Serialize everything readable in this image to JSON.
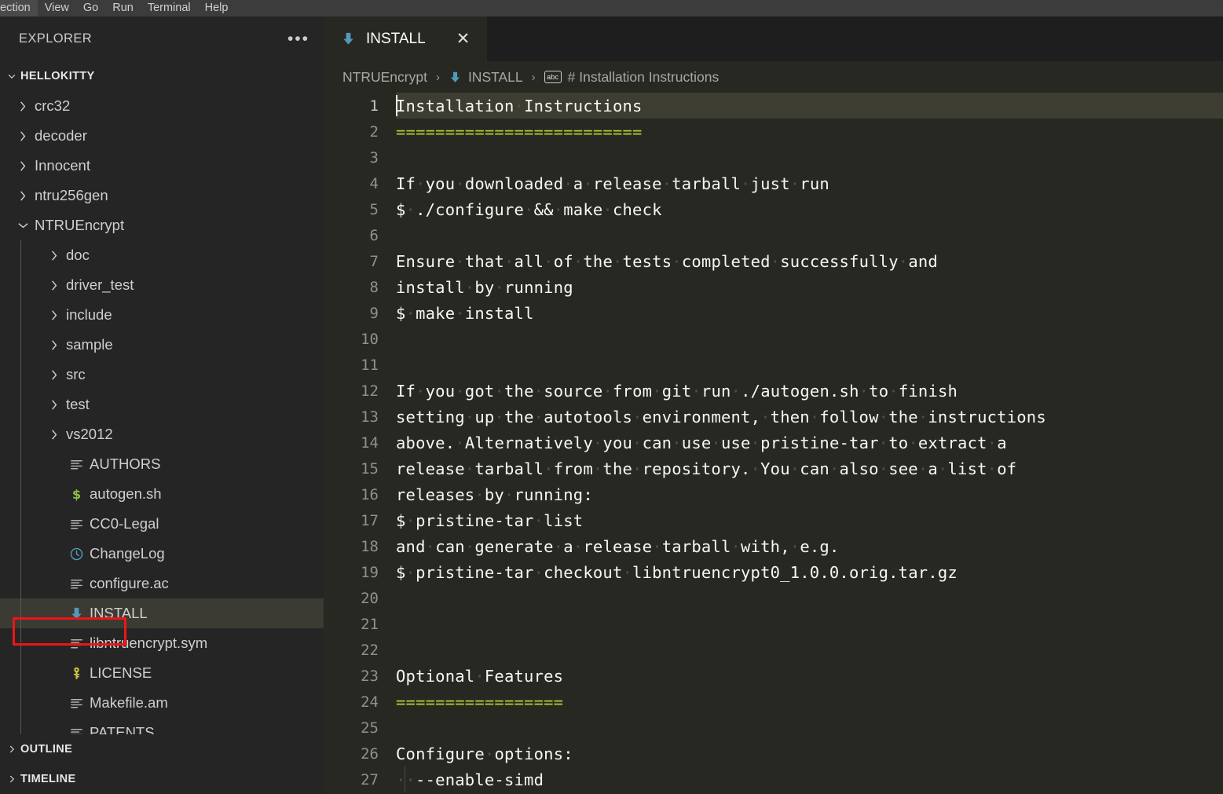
{
  "menubar": {
    "items": [
      "ection",
      "View",
      "Go",
      "Run",
      "Terminal",
      "Help"
    ]
  },
  "sidebar": {
    "title": "EXPLORER",
    "more_label": "•••",
    "root": {
      "label": "HELLOKITTY",
      "expanded": true
    },
    "tree": [
      {
        "label": "crc32",
        "type": "folder",
        "depth": 0,
        "expanded": false,
        "icon": "chevron-right-icon"
      },
      {
        "label": "decoder",
        "type": "folder",
        "depth": 0,
        "expanded": false,
        "icon": "chevron-right-icon"
      },
      {
        "label": "Innocent",
        "type": "folder",
        "depth": 0,
        "expanded": false,
        "icon": "chevron-right-icon"
      },
      {
        "label": "ntru256gen",
        "type": "folder",
        "depth": 0,
        "expanded": false,
        "icon": "chevron-right-icon"
      },
      {
        "label": "NTRUEncrypt",
        "type": "folder",
        "depth": 0,
        "expanded": true,
        "icon": "chevron-down-icon"
      },
      {
        "label": "doc",
        "type": "folder",
        "depth": 1,
        "expanded": false,
        "icon": "chevron-right-icon"
      },
      {
        "label": "driver_test",
        "type": "folder",
        "depth": 1,
        "expanded": false,
        "icon": "chevron-right-icon"
      },
      {
        "label": "include",
        "type": "folder",
        "depth": 1,
        "expanded": false,
        "icon": "chevron-right-icon"
      },
      {
        "label": "sample",
        "type": "folder",
        "depth": 1,
        "expanded": false,
        "icon": "chevron-right-icon"
      },
      {
        "label": "src",
        "type": "folder",
        "depth": 1,
        "expanded": false,
        "icon": "chevron-right-icon"
      },
      {
        "label": "test",
        "type": "folder",
        "depth": 1,
        "expanded": false,
        "icon": "chevron-right-icon"
      },
      {
        "label": "vs2012",
        "type": "folder",
        "depth": 1,
        "expanded": false,
        "icon": "chevron-right-icon"
      },
      {
        "label": "AUTHORS",
        "type": "file",
        "depth": 1,
        "icon": "text-lines-icon"
      },
      {
        "label": "autogen.sh",
        "type": "file",
        "depth": 1,
        "icon": "shell-dollar-icon"
      },
      {
        "label": "CC0-Legal",
        "type": "file",
        "depth": 1,
        "icon": "text-lines-icon"
      },
      {
        "label": "ChangeLog",
        "type": "file",
        "depth": 1,
        "icon": "clock-icon"
      },
      {
        "label": "configure.ac",
        "type": "file",
        "depth": 1,
        "icon": "text-lines-icon"
      },
      {
        "label": "INSTALL",
        "type": "file",
        "depth": 1,
        "icon": "download-arrow-icon",
        "selected": true,
        "highlighted": true
      },
      {
        "label": "libntruencrypt.sym",
        "type": "file",
        "depth": 1,
        "icon": "text-lines-icon"
      },
      {
        "label": "LICENSE",
        "type": "file",
        "depth": 1,
        "icon": "key-icon"
      },
      {
        "label": "Makefile.am",
        "type": "file",
        "depth": 1,
        "icon": "text-lines-icon"
      },
      {
        "label": "PATENTS",
        "type": "file",
        "depth": 1,
        "icon": "text-lines-icon"
      }
    ],
    "panels": [
      {
        "label": "OUTLINE",
        "expanded": false
      },
      {
        "label": "TIMELINE",
        "expanded": false
      }
    ]
  },
  "editor": {
    "tab": {
      "label": "INSTALL",
      "icon": "download-arrow-icon",
      "close_label": "✕",
      "active": true
    },
    "breadcrumb": [
      {
        "label": "NTRUEncrypt",
        "icon": null
      },
      {
        "label": "INSTALL",
        "icon": "download-arrow-icon"
      },
      {
        "label": "# Installation Instructions",
        "icon": "abc-symbol-icon"
      }
    ],
    "breadcrumb_separator": "›",
    "cursor_line": 1,
    "lines": [
      {
        "n": 1,
        "text": "Installation·Instructions",
        "active": true
      },
      {
        "n": 2,
        "text": "=========================",
        "eq": true
      },
      {
        "n": 3,
        "text": ""
      },
      {
        "n": 4,
        "text": "If·you·downloaded·a·release·tarball·just·run"
      },
      {
        "n": 5,
        "text": "$·./configure·&&·make·check"
      },
      {
        "n": 6,
        "text": ""
      },
      {
        "n": 7,
        "text": "Ensure·that·all·of·the·tests·completed·successfully·and"
      },
      {
        "n": 8,
        "text": "install·by·running"
      },
      {
        "n": 9,
        "text": "$·make·install"
      },
      {
        "n": 10,
        "text": ""
      },
      {
        "n": 11,
        "text": ""
      },
      {
        "n": 12,
        "text": "If·you·got·the·source·from·git·run·./autogen.sh·to·finish"
      },
      {
        "n": 13,
        "text": "setting·up·the·autotools·environment,·then·follow·the·instructions"
      },
      {
        "n": 14,
        "text": "above.·Alternatively·you·can·use·use·pristine-tar·to·extract·a"
      },
      {
        "n": 15,
        "text": "release·tarball·from·the·repository.·You·can·also·see·a·list·of"
      },
      {
        "n": 16,
        "text": "releases·by·running:"
      },
      {
        "n": 17,
        "text": "$·pristine-tar·list"
      },
      {
        "n": 18,
        "text": "and·can·generate·a·release·tarball·with,·e.g."
      },
      {
        "n": 19,
        "text": "$·pristine-tar·checkout·libntruencrypt0_1.0.0.orig.tar.gz"
      },
      {
        "n": 20,
        "text": ""
      },
      {
        "n": 21,
        "text": ""
      },
      {
        "n": 22,
        "text": ""
      },
      {
        "n": 23,
        "text": "Optional·Features"
      },
      {
        "n": 24,
        "text": "=================",
        "eq": true
      },
      {
        "n": 25,
        "text": ""
      },
      {
        "n": 26,
        "text": "Configure·options:"
      },
      {
        "n": 27,
        "text": "··--enable-simd",
        "guide": true
      }
    ]
  },
  "colors": {
    "editor_bg": "#272822",
    "sidebar_bg": "#252526",
    "menubar_bg": "#3c3c3c",
    "tabbar_bg": "#1e1e1e",
    "accent_blue": "#519aba",
    "shell_green": "#8dc149",
    "key_yellow": "#cbcb41",
    "heading_green": "#b2d037",
    "annotation_red": "#f01414",
    "active_line": "#3e3d32",
    "selected_row": "#3b3b33"
  }
}
